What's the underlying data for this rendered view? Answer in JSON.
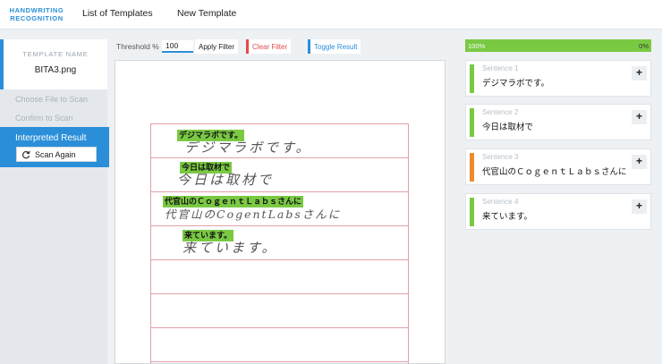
{
  "app": {
    "logo_line1": "HANDWRITING",
    "logo_line2": "RECOGNITION"
  },
  "nav": {
    "list_templates": "List of Templates",
    "new_template": "New Template"
  },
  "sidebar": {
    "template_label": "TEMPLATE NAME",
    "template_file": "BITA3.png",
    "steps": {
      "choose": "Choose File to Scan",
      "confirm": "Confirm to Scan",
      "interpreted": "Interpreted Result"
    },
    "scan_again": "Scan Again"
  },
  "toolbar": {
    "threshold_label": "Threshold %",
    "threshold_value": "100",
    "apply": "Apply Filter",
    "clear": "Clear Filter",
    "toggle": "Toggle Result"
  },
  "document": {
    "handwriting": [
      "デジマラボです。",
      "今日は取材で",
      "代官山のCogentLabsさんに",
      "来ています。"
    ],
    "highlights": [
      "デジマラボです。",
      "今日は取材で",
      "代官山のＣｏｇｅｎｔＬａｂｓさんに",
      "来ています。"
    ]
  },
  "progress": {
    "value_percent": 100,
    "left_label": "100%",
    "right_label": "0%"
  },
  "sentences": [
    {
      "label": "Sentence 1",
      "text": "デジマラボです。",
      "status_color": "#7ac943"
    },
    {
      "label": "Sentence 2",
      "text": "今日は取材で",
      "status_color": "#7ac943"
    },
    {
      "label": "Sentence 3",
      "text": "代官山のＣｏｇｅｎｔＬａｂｓさんに",
      "status_color": "#f08a2c"
    },
    {
      "label": "Sentence 4",
      "text": "来ています。",
      "status_color": "#7ac943"
    }
  ],
  "plus_symbol": "+",
  "colors": {
    "accent": "#2a8fd8",
    "success": "#7ac943",
    "warning": "#f08a2c",
    "danger": "#e24a4a"
  }
}
